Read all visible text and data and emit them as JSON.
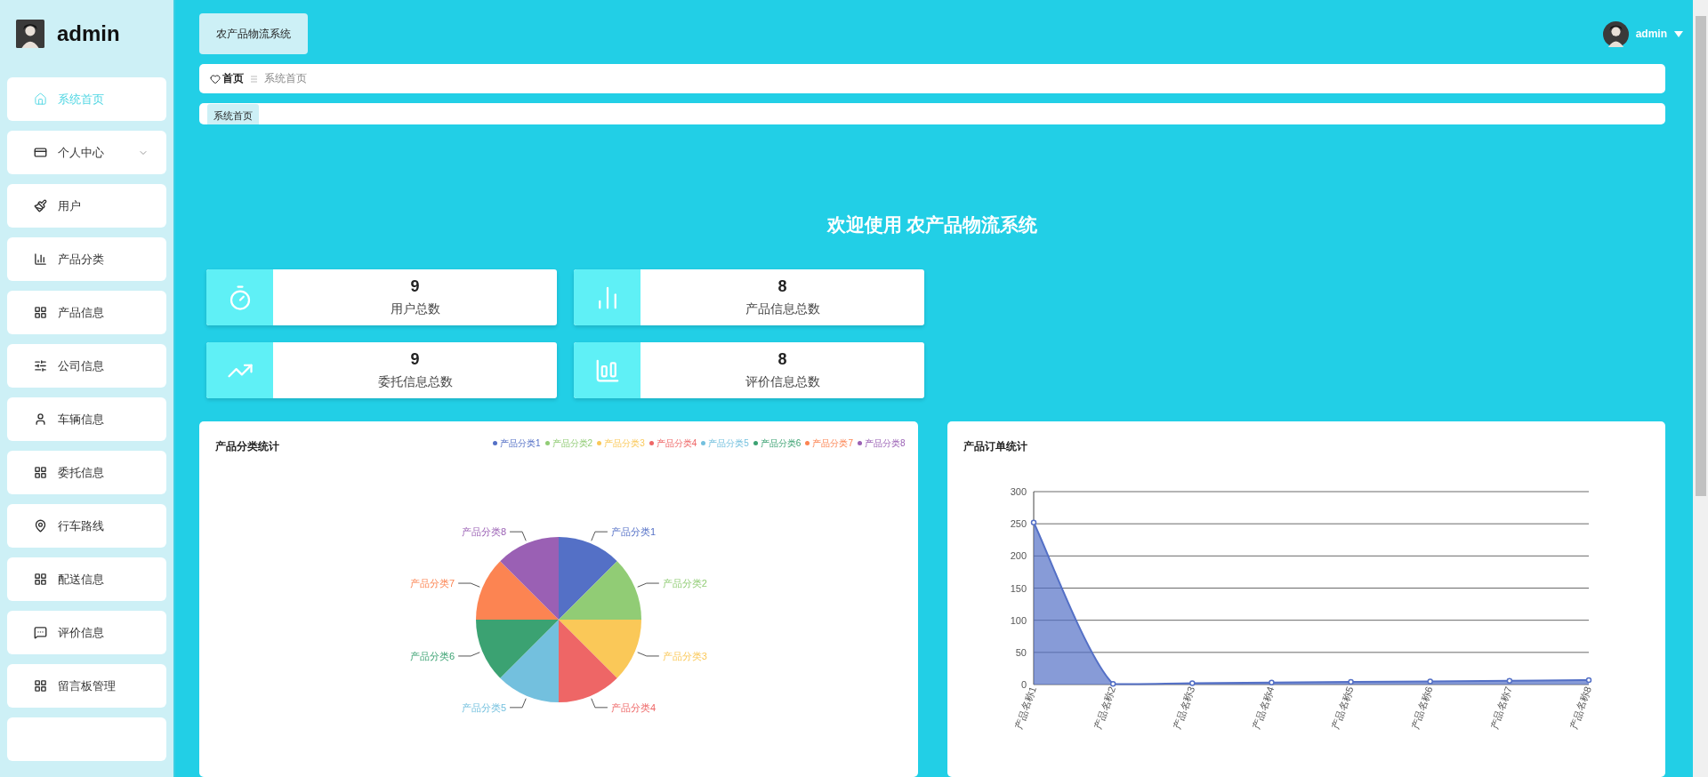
{
  "sidebar": {
    "user": "admin",
    "items": [
      {
        "label": "系统首页",
        "selected": true,
        "submenu": false
      },
      {
        "label": "个人中心",
        "selected": false,
        "submenu": true
      },
      {
        "label": "用户",
        "selected": false,
        "submenu": false
      },
      {
        "label": "产品分类",
        "selected": false,
        "submenu": false
      },
      {
        "label": "产品信息",
        "selected": false,
        "submenu": false
      },
      {
        "label": "公司信息",
        "selected": false,
        "submenu": false
      },
      {
        "label": "车辆信息",
        "selected": false,
        "submenu": false
      },
      {
        "label": "委托信息",
        "selected": false,
        "submenu": false
      },
      {
        "label": "行车路线",
        "selected": false,
        "submenu": false
      },
      {
        "label": "配送信息",
        "selected": false,
        "submenu": false
      },
      {
        "label": "评价信息",
        "selected": false,
        "submenu": false
      },
      {
        "label": "留言板管理",
        "selected": false,
        "submenu": false
      }
    ]
  },
  "header": {
    "system_title": "农产品物流系统",
    "user": "admin"
  },
  "breadcrumb": [
    "首页",
    "系统首页"
  ],
  "tags": [
    {
      "label": "系统首页",
      "selected": true
    }
  ],
  "welcome": {
    "prefix": "欢迎使用",
    "name": "农产品物流系统"
  },
  "stats": [
    {
      "value": "9",
      "label": "用户总数"
    },
    {
      "value": "8",
      "label": "产品信息总数"
    },
    {
      "value": "9",
      "label": "委托信息总数"
    },
    {
      "value": "8",
      "label": "评价信息总数"
    }
  ],
  "pie_card": {
    "title": "产品分类统计",
    "legend": [
      {
        "label": "产品分类1",
        "color": "#5470c6"
      },
      {
        "label": "产品分类2",
        "color": "#91cc75"
      },
      {
        "label": "产品分类3",
        "color": "#fac858"
      },
      {
        "label": "产品分类4",
        "color": "#ee6666"
      },
      {
        "label": "产品分类5",
        "color": "#73c0de"
      },
      {
        "label": "产品分类6",
        "color": "#3ba272"
      },
      {
        "label": "产品分类7",
        "color": "#fc8452"
      },
      {
        "label": "产品分类8",
        "color": "#9a60b4"
      }
    ],
    "chart_data": {
      "type": "pie",
      "categories": [
        "产品分类1",
        "产品分类2",
        "产品分类3",
        "产品分类4",
        "产品分类5",
        "产品分类6",
        "产品分类7",
        "产品分类8"
      ],
      "series": [
        {
          "values": [
            1,
            1,
            1,
            1,
            1,
            1,
            1,
            1
          ]
        }
      ]
    }
  },
  "line_card": {
    "title": "产品订单统计",
    "chart_data": {
      "type": "area",
      "categories": [
        "产品名称1",
        "产品名称2",
        "产品名称3",
        "产品名称4",
        "产品名称5",
        "产品名称6",
        "产品名称7",
        "产品名称8"
      ],
      "series": [
        {
          "color": "#5470c6",
          "values": [
            252,
            1,
            2,
            3,
            4,
            5,
            6,
            7
          ]
        }
      ],
      "grid": true,
      "ylim": [
        0,
        300
      ],
      "yticks": [
        0,
        50,
        100,
        150,
        200,
        250,
        300
      ]
    }
  }
}
